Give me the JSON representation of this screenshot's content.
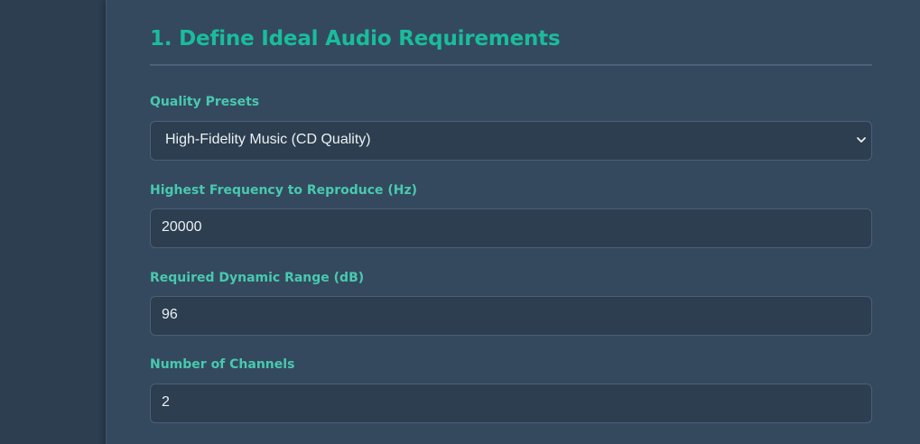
{
  "section": {
    "title": "1. Define Ideal Audio Requirements"
  },
  "fields": {
    "quality_presets": {
      "label": "Quality Presets",
      "selected": "High-Fidelity Music (CD Quality)"
    },
    "highest_frequency": {
      "label": "Highest Frequency to Reproduce (Hz)",
      "value": "20000"
    },
    "dynamic_range": {
      "label": "Required Dynamic Range (dB)",
      "value": "96"
    },
    "channels": {
      "label": "Number of Channels",
      "value": "2"
    }
  },
  "icons": {
    "select_arrow": "chevron-down-icon"
  },
  "colors": {
    "page_background": "#2c3e50",
    "card_background": "#34495e",
    "title_accent": "#1abc9c",
    "label_accent": "#48c9b0",
    "input_background": "#2c3e50",
    "input_border": "#4b6079",
    "input_text": "#ecf0f1"
  }
}
